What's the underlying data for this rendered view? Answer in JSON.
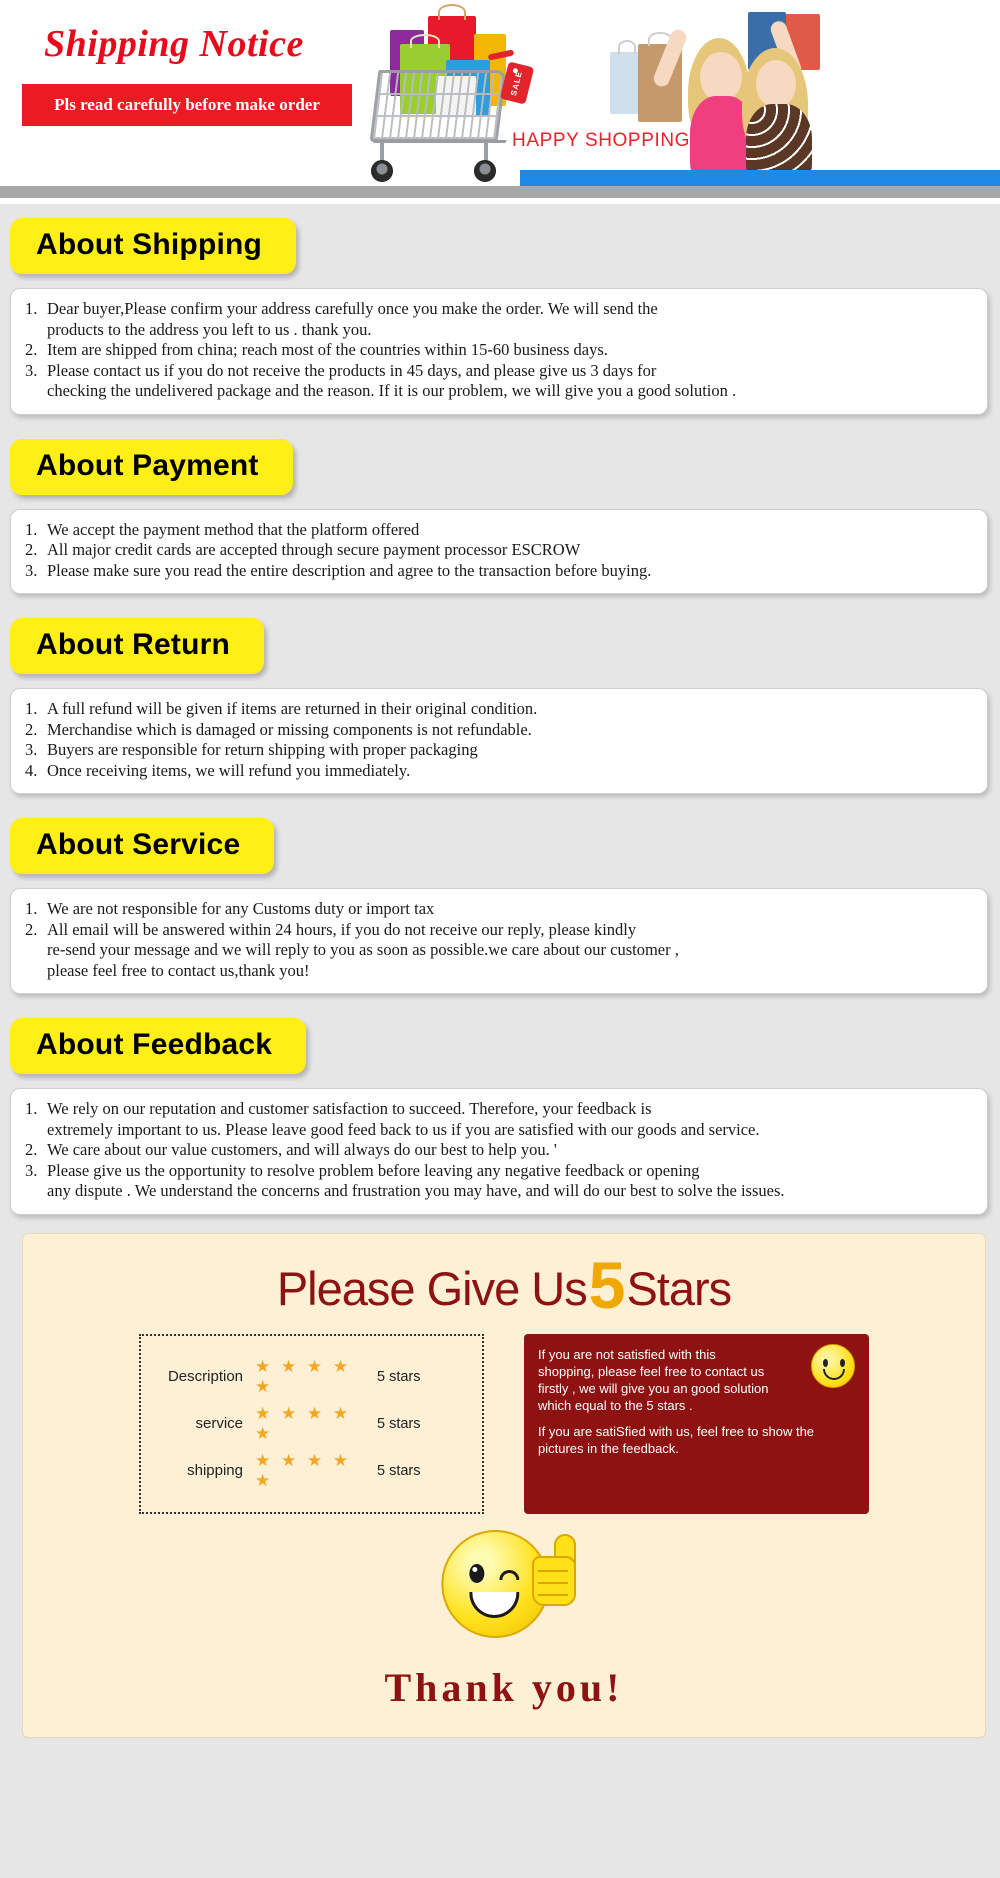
{
  "header": {
    "title": "Shipping Notice",
    "ribbon": "Pls read carefully before make order",
    "happy_shopping": "HAPPY SHOPPING",
    "sale_tag": "SALE",
    "accent_red": "#ec1b23",
    "accent_blue": "#1e8ae5"
  },
  "sections": [
    {
      "badge": "About Shipping",
      "items": [
        {
          "num": "1.",
          "lines": [
            "Dear buyer,Please confirm your address carefully once you make the order. We will send the",
            "products to the address you left to us . thank you."
          ]
        },
        {
          "num": "2.",
          "lines": [
            "Item are shipped from china; reach most of the countries within 15-60 business days."
          ]
        },
        {
          "num": "3.",
          "lines": [
            "Please contact us if you do not receive the products in 45 days, and please give us 3 days for",
            "checking the undelivered package and the reason. If it is our problem, we will give you a good solution ."
          ]
        }
      ]
    },
    {
      "badge": "About Payment",
      "items": [
        {
          "num": "1.",
          "lines": [
            "We accept the payment method that the platform offered"
          ]
        },
        {
          "num": "2.",
          "lines": [
            "All major credit cards are accepted through secure payment processor ESCROW"
          ]
        },
        {
          "num": "3.",
          "lines": [
            "Please make sure you read the entire description and agree to the transaction before buying."
          ]
        }
      ]
    },
    {
      "badge": "About Return",
      "items": [
        {
          "num": "1.",
          "lines": [
            "A full refund will be given if items are returned in their original condition."
          ]
        },
        {
          "num": "2.",
          "lines": [
            "Merchandise which is damaged or missing components is not refundable."
          ]
        },
        {
          "num": "3.",
          "lines": [
            "Buyers are responsible for return shipping with proper packaging"
          ]
        },
        {
          "num": "4.",
          "lines": [
            "Once receiving items, we will refund you immediately."
          ]
        }
      ]
    },
    {
      "badge": "About Service",
      "items": [
        {
          "num": "1.",
          "lines": [
            "We are not responsible for any Customs duty or import tax"
          ]
        },
        {
          "num": "2.",
          "lines": [
            "All email will be answered within 24 hours, if you do not receive our reply, please kindly",
            "re-send your message and we will reply to you as soon as possible.we care about our customer ,",
            "please feel free to contact us,thank you!"
          ]
        }
      ]
    },
    {
      "badge": "About Feedback",
      "items": [
        {
          "num": "1.",
          "lines": [
            "We rely on our reputation and customer satisfaction to succeed. Therefore, your feedback is",
            "extremely important to us. Please leave good feed back to us if you are satisfied with our goods and service."
          ]
        },
        {
          "num": "2.",
          "lines": [
            "We care about our value customers, and will always do our best to help you. '"
          ]
        },
        {
          "num": "3.",
          "lines": [
            "Please give us the opportunity to resolve problem before leaving any negative feedback or opening",
            "any dispute . We understand the concerns and frustration you may have, and will do our best to solve the issues."
          ]
        }
      ]
    }
  ],
  "footer": {
    "give_us_pre": "Please Give Us",
    "big_number": "5",
    "give_us_post": "Stars",
    "ratings": [
      {
        "label": "Description",
        "stars": "★ ★ ★ ★ ★",
        "value": "5 stars"
      },
      {
        "label": "service",
        "stars": "★ ★ ★ ★ ★",
        "value": "5 stars"
      },
      {
        "label": "shipping",
        "stars": "★ ★ ★ ★ ★",
        "value": "5 stars"
      }
    ],
    "notice_1": "If you are not satisfied with this shopping, please feel free to contact us firstly , we will give you an good solution which equal to the 5 stars .",
    "notice_2": "If you are satiSfied with us, feel free to show the pictures in the feedback.",
    "thank_you": "Thank you!",
    "panel_bg": "#fdf0d5",
    "dark_red": "#8e1212"
  }
}
